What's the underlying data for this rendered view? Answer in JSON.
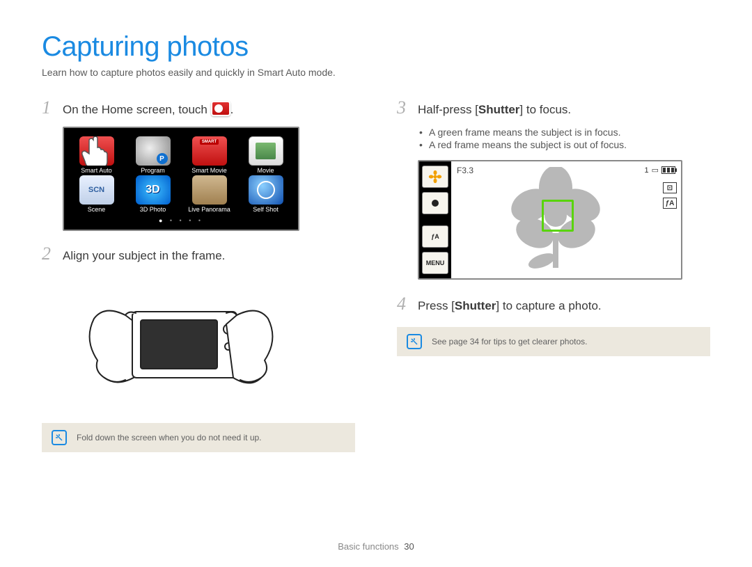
{
  "title": "Capturing photos",
  "subtitle": "Learn how to capture photos easily and quickly in Smart Auto mode.",
  "steps": {
    "s1_num": "1",
    "s1_a": "On the Home screen, touch ",
    "s1_b": ".",
    "s2_num": "2",
    "s2": "Align your subject in the frame.",
    "s3_num": "3",
    "s3_a": "Half-press [",
    "s3_bold": "Shutter",
    "s3_b": "] to focus.",
    "s4_num": "4",
    "s4_a": "Press [",
    "s4_bold": "Shutter",
    "s4_b": "] to capture a photo."
  },
  "home_items": [
    {
      "label": "Smart Auto",
      "cls": "ic-smart"
    },
    {
      "label": "Program",
      "cls": "ic-program"
    },
    {
      "label": "Smart Movie",
      "cls": "ic-smov"
    },
    {
      "label": "Movie",
      "cls": "ic-movie"
    },
    {
      "label": "Scene",
      "cls": "ic-scene",
      "inner": "SCN"
    },
    {
      "label": "3D Photo",
      "cls": "ic-3d",
      "inner": "3D"
    },
    {
      "label": "Live Panorama",
      "cls": "ic-pano"
    },
    {
      "label": "Self Shot",
      "cls": "ic-self"
    }
  ],
  "bullets": {
    "b1": "A green frame means the subject is in focus.",
    "b2": "A red frame means the subject is out of focus."
  },
  "viewfinder": {
    "aperture": "F3.3",
    "count": "1",
    "flash_label": "ƒA",
    "menu_label": "MENU",
    "side_r1": "⊡",
    "side_r2": "ƒA"
  },
  "note1": "Fold down the screen when you do not need it up.",
  "note2": "See page 34 for tips to get clearer photos.",
  "footer_section": "Basic functions",
  "footer_page": "30"
}
